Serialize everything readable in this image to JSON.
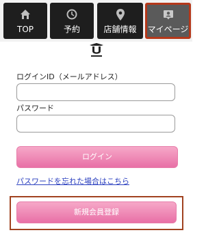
{
  "nav": {
    "items": [
      {
        "label": "TOP",
        "icon": "home-icon"
      },
      {
        "label": "予約",
        "icon": "clock-icon"
      },
      {
        "label": "店舗情報",
        "icon": "map-pin-icon"
      },
      {
        "label": "マイページ",
        "icon": "profile-card-icon",
        "active": true
      }
    ]
  },
  "login": {
    "id_label": "ログインID（メールアドレス）",
    "id_value": "",
    "password_label": "パスワード",
    "password_value": "",
    "login_button": "ログイン",
    "forgot_link": "パスワードを忘れた場合はこちら",
    "register_button": "新規会員登録"
  },
  "colors": {
    "nav_bg": "#1e1e1e",
    "active_nav_bg": "#5a5a5a",
    "highlight_border": "#b5381a",
    "button_pink": "#ee8ab6",
    "link_blue": "#2a3fbf"
  }
}
